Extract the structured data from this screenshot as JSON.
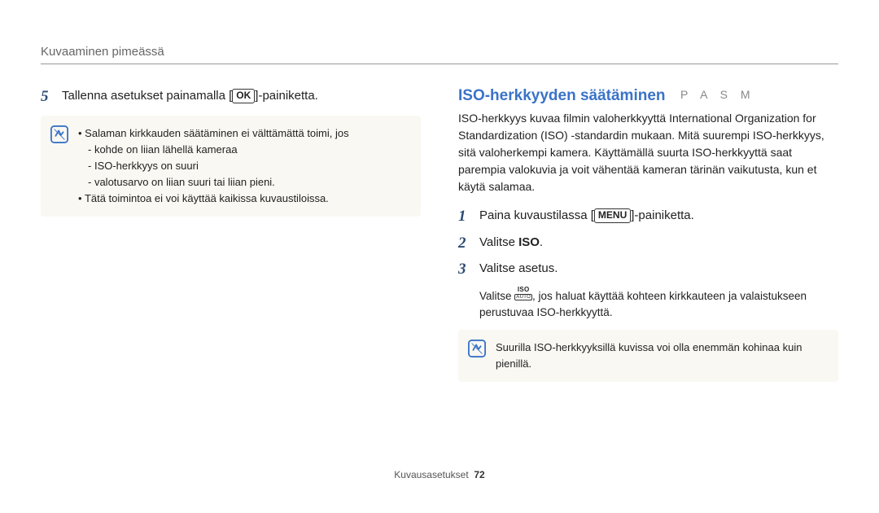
{
  "header": {
    "title": "Kuvaaminen pimeässä"
  },
  "left": {
    "step5_num": "5",
    "step5_pre": "Tallenna asetukset painamalla [",
    "step5_key": "OK",
    "step5_post": "]-painiketta.",
    "note_line1": "Salaman kirkkauden säätäminen ei välttämättä toimi, jos",
    "note_bul1": "kohde on liian lähellä kameraa",
    "note_bul2": "ISO-herkkyys on suuri",
    "note_bul3": "valotusarvo on liian suuri tai liian pieni.",
    "note_line2": "Tätä toimintoa ei voi käyttää kaikissa kuvaustiloissa."
  },
  "right": {
    "heading": "ISO-herkkyyden säätäminen",
    "modes": "P A S M",
    "intro": "ISO-herkkyys kuvaa filmin valoherkkyyttä International Organization for Standardization (ISO) -standardin mukaan. Mitä suurempi ISO-herkkyys, sitä valoherkempi kamera. Käyttämällä suurta ISO-herkkyyttä saat parempia valokuvia ja voit vähentää kameran tärinän vaikutusta, kun et käytä salamaa.",
    "step1_num": "1",
    "step1_pre": "Paina kuvaustilassa [",
    "step1_key": "MENU",
    "step1_post": "]-painiketta.",
    "step2_num": "2",
    "step2_pre": "Valitse ",
    "step2_bold": "ISO",
    "step2_post": ".",
    "step3_num": "3",
    "step3_text": "Valitse asetus.",
    "step3_sub_pre": "Valitse ",
    "step3_sub_post": ", jos haluat käyttää kohteen kirkkauteen ja valaistukseen perustuvaa ISO-herkkyyttä.",
    "note": "Suurilla ISO-herkkyyksillä kuvissa voi olla enemmän kohinaa kuin pienillä."
  },
  "footer": {
    "section": "Kuvausasetukset",
    "page": "72"
  }
}
